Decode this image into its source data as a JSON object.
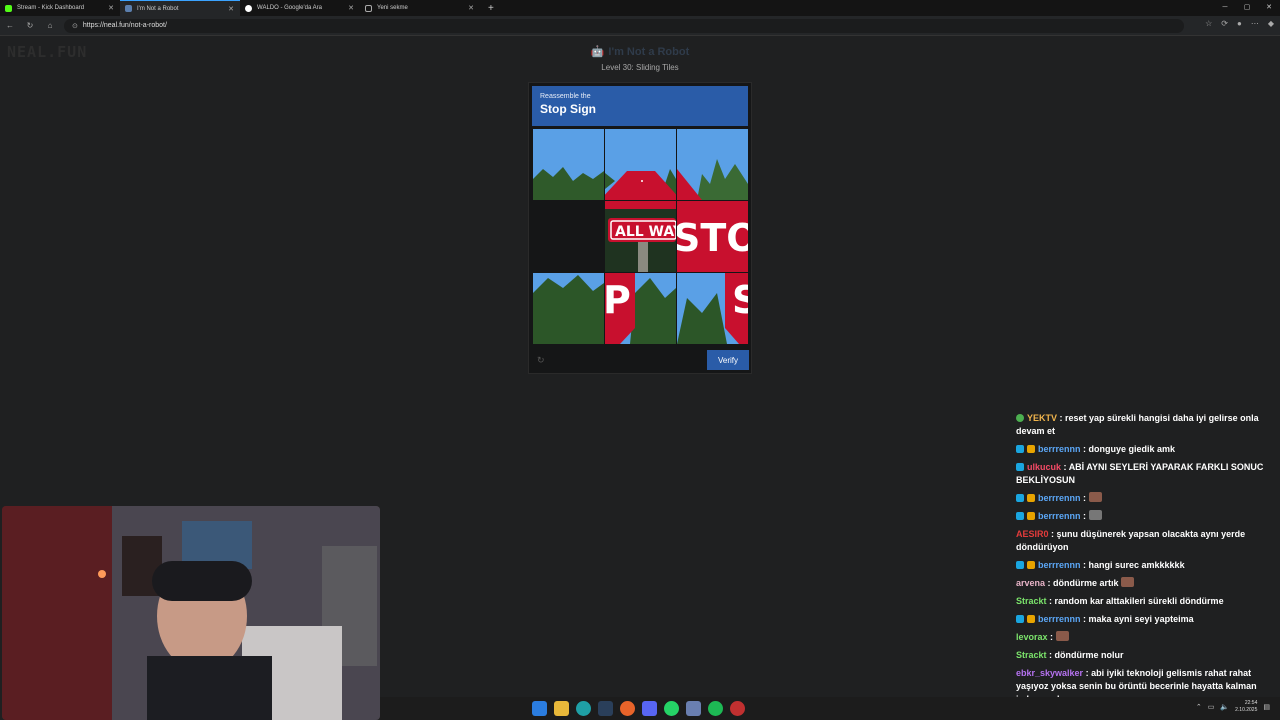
{
  "browser": {
    "tabs": [
      {
        "title": "Stream - Kick Dashboard",
        "icon": "kick-icon",
        "color": "#53fc18"
      },
      {
        "title": "I'm Not a Robot",
        "icon": "robot-icon",
        "color": "#5b7fae"
      },
      {
        "title": "WALDO - Google'da Ara",
        "icon": "google-icon",
        "color": "#ffffff"
      },
      {
        "title": "Yeni sekme",
        "icon": "page-icon",
        "color": "#aaaaaa"
      }
    ],
    "url": "https://neal.fun/not-a-robot/"
  },
  "page": {
    "logo": "NEAL.FUN",
    "title": "I'm Not a Robot",
    "level": "Level 30: Sliding Tiles"
  },
  "captcha": {
    "instruction": "Reassemble the",
    "target": "Stop Sign",
    "verify_label": "Verify",
    "header_color": "#2a5ca8"
  },
  "chat": [
    {
      "user": "YEKTV",
      "color": "#f0b44c",
      "text": "reset yap sürekli hangisi daha iyi gelirse onla devam et",
      "emote": false
    },
    {
      "user": "berrrennn",
      "color": "#5ba6f5",
      "text": "donguye giedik amk",
      "emote": false
    },
    {
      "user": "ulkucuk",
      "color": "#f54a66",
      "text": "ABİ AYNI SEYLERİ YAPARAK FARKLI SONUC BEKLİYOSUN",
      "emote": false
    },
    {
      "user": "berrrennn",
      "color": "#5ba6f5",
      "text": "",
      "emote": true
    },
    {
      "user": "berrrennn",
      "color": "#5ba6f5",
      "text": "",
      "emote": true
    },
    {
      "user": "AESIR0",
      "color": "#e33b3b",
      "text": "şunu düşünerek yapsan olacakta aynı yerde döndürüyon",
      "emote": false
    },
    {
      "user": "berrrennn",
      "color": "#5ba6f5",
      "text": "hangi surec amkkkkkk",
      "emote": false
    },
    {
      "user": "arvena",
      "color": "#e7b3c7",
      "text": "döndürme artık",
      "emote": true
    },
    {
      "user": "Strackt",
      "color": "#7be36b",
      "text": "random kar alttakileri sürekli döndürme",
      "emote": false
    },
    {
      "user": "berrrennn",
      "color": "#5ba6f5",
      "text": "maka ayni seyi yapteima",
      "emote": false
    },
    {
      "user": "levorax",
      "color": "#7be36b",
      "text": "",
      "emote": true
    },
    {
      "user": "Strackt",
      "color": "#7be36b",
      "text": "döndürme nolur",
      "emote": false
    },
    {
      "user": "ebkr_skywalker",
      "color": "#b572f0",
      "text": "abi iyiki teknoloji gelismis rahat rahat yaşıyoz yoksa senin bu örüntü becerinle hayatta kalman imkansızdı",
      "emote": false
    }
  ],
  "taskbar": {
    "time": "22:54",
    "date": "2.10.2025"
  }
}
